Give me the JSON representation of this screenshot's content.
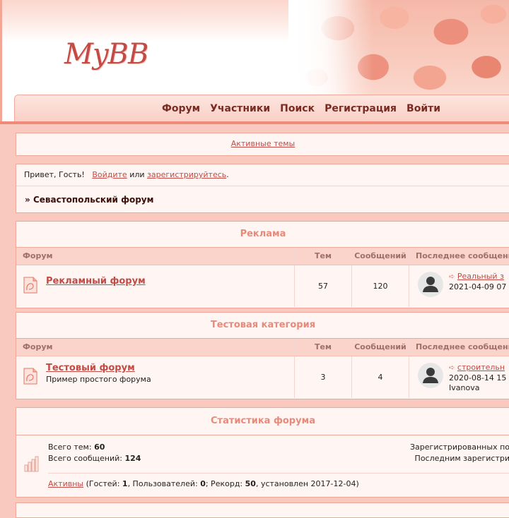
{
  "header": {
    "logo_text": "MyBB",
    "nav": [
      "Форум",
      "Участники",
      "Поиск",
      "Регистрация",
      "Войти"
    ]
  },
  "active_topics_link": "Активные темы",
  "welcome": {
    "greeting": "Привет, Гость!",
    "login_link": "Войдите",
    "or": "или",
    "register_link": "зарегистрируйтесь",
    "dot": "."
  },
  "breadcrumb": {
    "prefix": "»",
    "title": "Севастопольский форум"
  },
  "categories": [
    {
      "title": "Реклама",
      "headers": {
        "forum": "Форум",
        "topics": "Тем",
        "posts": "Сообщений",
        "last": "Последнее сообщение"
      },
      "forums": [
        {
          "name": "Рекламный форум",
          "desc": "",
          "topics": "57",
          "posts": "120",
          "last_link": "Реальный з",
          "last_date": "2021-04-09 07",
          "last_user": ""
        }
      ]
    },
    {
      "title": "Тестовая категория",
      "headers": {
        "forum": "Форум",
        "topics": "Тем",
        "posts": "Сообщений",
        "last": "Последнее сообщени"
      },
      "forums": [
        {
          "name": "Тестовый форум",
          "desc": "Пример простого форума",
          "topics": "3",
          "posts": "4",
          "last_link": "строительн",
          "last_date": "2020-08-14 15",
          "last_user": "Ivanova"
        }
      ]
    }
  ],
  "stats": {
    "title": "Статистика форума",
    "topics_label": "Всего тем:",
    "topics_value": "60",
    "posts_label": "Всего сообщений:",
    "posts_value": "124",
    "registered_label": "Зарегистрированных по",
    "last_registered_label": "Последним зарегистри",
    "online_link": "Активны",
    "online_open": "(Гостей:",
    "guests": "1",
    "users_label": ", Пользователей:",
    "users": "0",
    "record_label": "; Рекорд:",
    "record": "50",
    "record_date": ", установлен 2017-12-04)"
  },
  "colors": {
    "accent": "#c24b46",
    "category_title": "#e88a7a",
    "nav_text": "#7a2c22",
    "header_line": "#f08a78"
  }
}
